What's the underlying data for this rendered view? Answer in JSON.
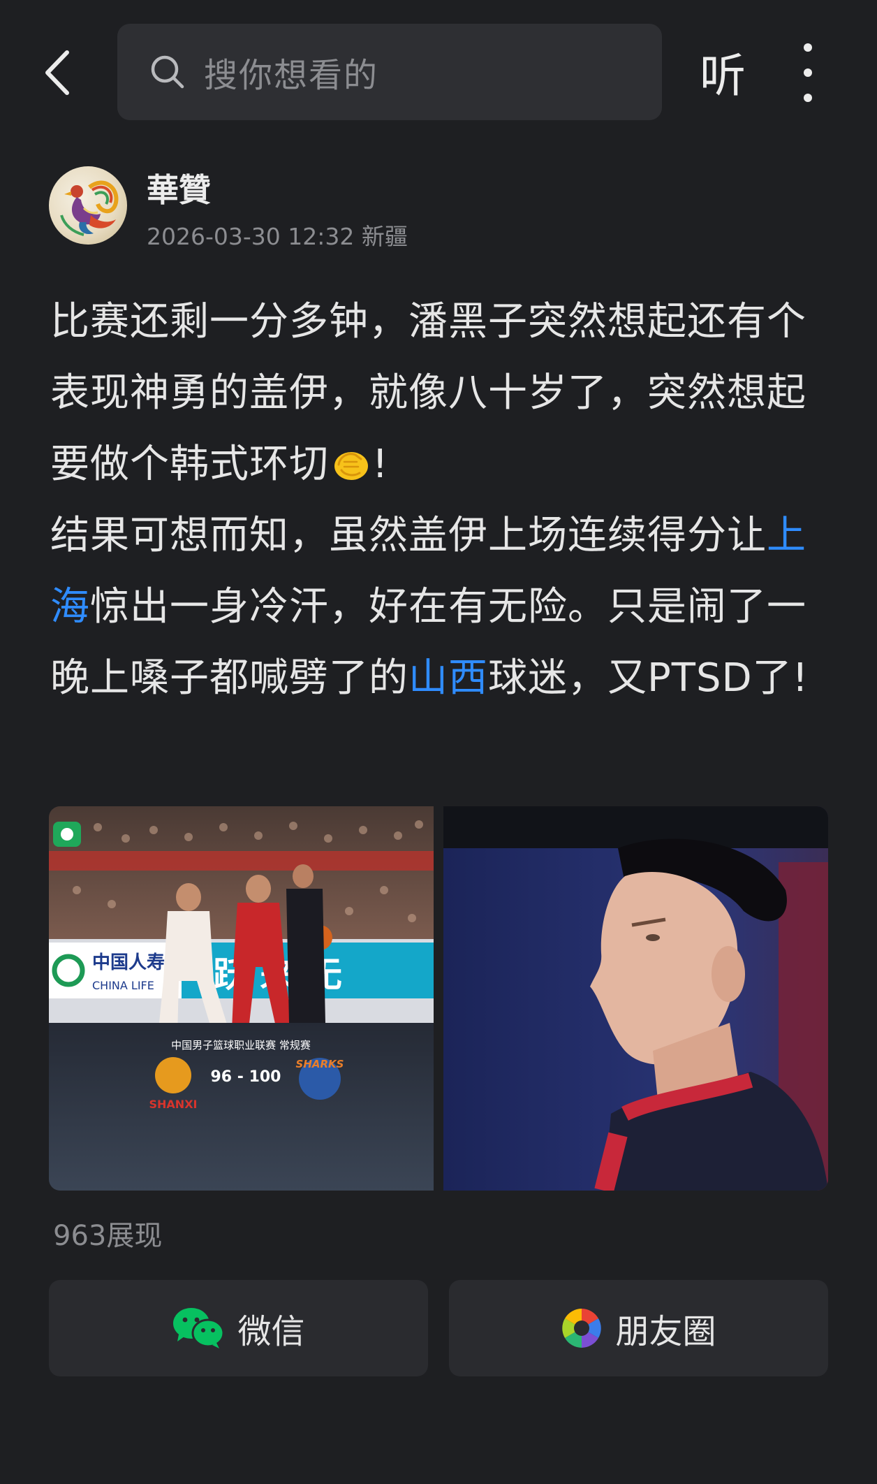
{
  "topbar": {
    "search_placeholder": "搜你想看的",
    "listen_label": "听"
  },
  "author": {
    "name": "華贊",
    "timestamp": "2026-03-30 12:32",
    "location": "新疆"
  },
  "post": {
    "p1": "比赛还剩一分多钟，潘黑子突然想起还有个表现神勇的盖伊，就像八十岁了，突然想起要做个韩式环切",
    "p1_emoji": "clapping-hands-icon",
    "p1_end": "!",
    "p2_a": "结果可想而知，虽然盖伊上场连续得分让",
    "p2_link1": "上海",
    "p2_b": "惊出一身冷汗，好在有无险。只是闹了一晚上嗓子都喊劈了的",
    "p2_link2": "山西",
    "p2_c": "球迷，又PTSD了!"
  },
  "images": {
    "left": {
      "league": "中国男子篮球职业联赛 常规赛",
      "score": "96 - 100",
      "sponsor_cn": "中国人寿",
      "sponsor_en": "CHINA LIFE",
      "banner_text": "跃 来 无",
      "team_left": "SHANXI",
      "team_right": "SHARKS"
    }
  },
  "stats": {
    "views": "963展现"
  },
  "share": {
    "wechat_label": "微信",
    "moments_label": "朋友圈"
  },
  "colors": {
    "background": "#1e1f22",
    "link": "#2f8cff",
    "wechat_green": "#07c160"
  }
}
